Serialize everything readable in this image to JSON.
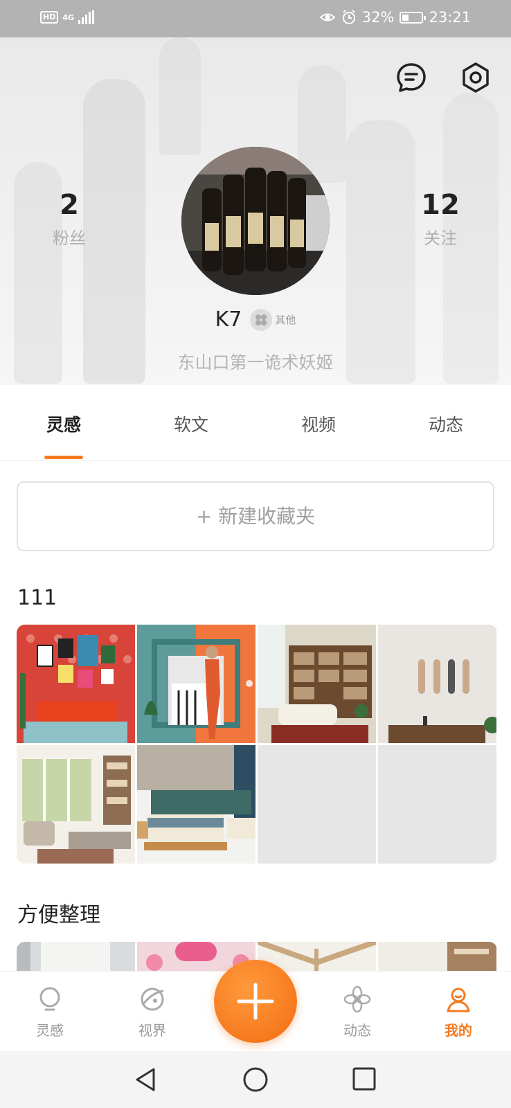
{
  "status_bar": {
    "hd": "HD",
    "network": "4G",
    "battery": "32%",
    "time": "23:21"
  },
  "profile": {
    "followers_count": "2",
    "followers_label": "粉丝",
    "following_count": "12",
    "following_label": "关注",
    "username": "K7",
    "tag": "其他",
    "bio": "东山口第一诡术妖姬"
  },
  "tabs": [
    "灵感",
    "软文",
    "视频",
    "动态"
  ],
  "new_folder_label": "+ 新建收藏夹",
  "collections": [
    {
      "title": "111"
    },
    {
      "title": "方便整理"
    }
  ],
  "bottom_nav": {
    "inspiration": "灵感",
    "vision": "视界",
    "moments": "动态",
    "mine": "我的"
  },
  "colors": {
    "accent": "#f47b20",
    "status_bar": "#b3b3b3"
  }
}
